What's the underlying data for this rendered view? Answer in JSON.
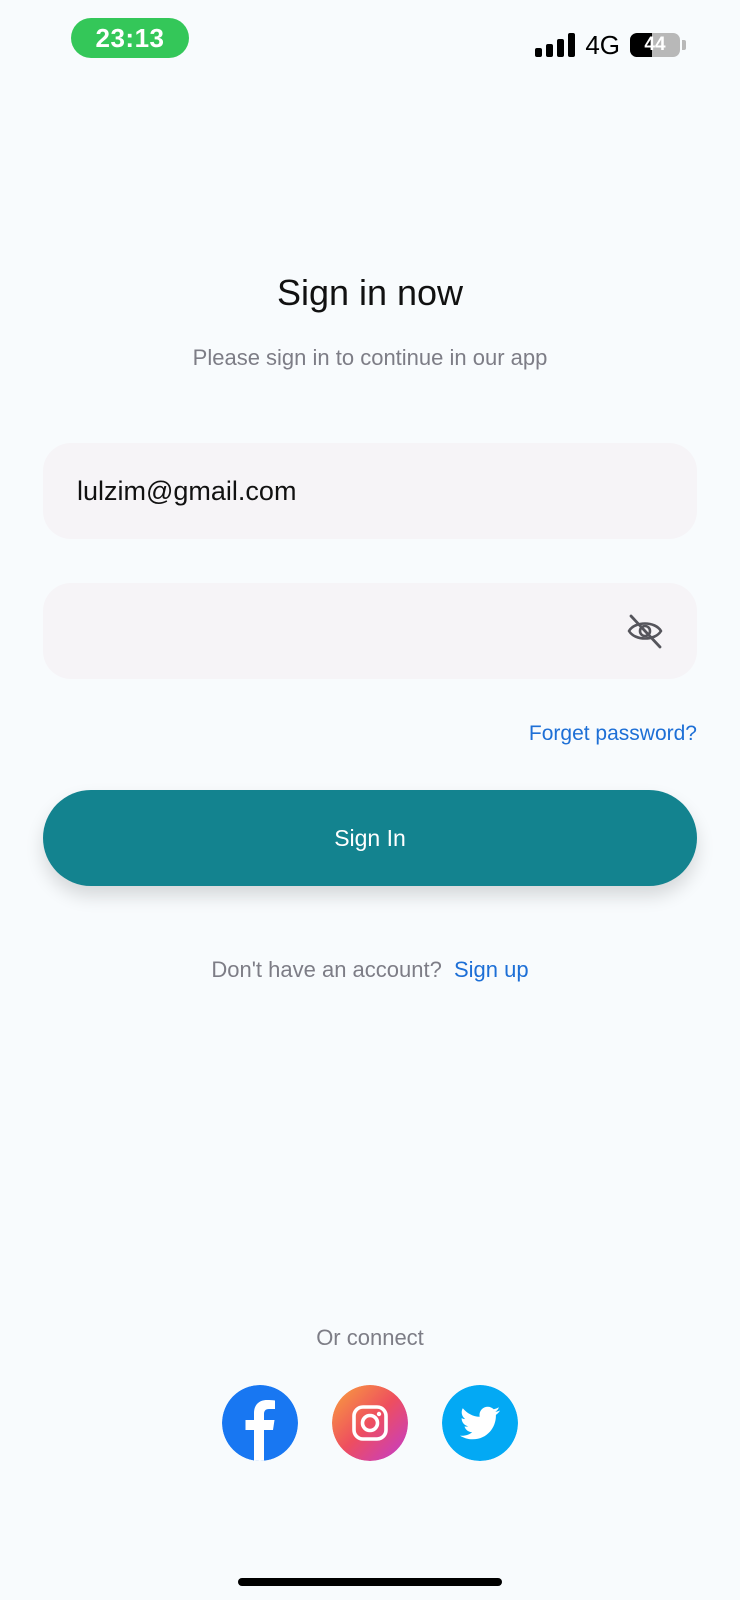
{
  "status_bar": {
    "time": "23:13",
    "network": "4G",
    "battery": "44",
    "battery_level": 0.44
  },
  "title": "Sign in now",
  "subtitle": "Please sign in to continue in our app",
  "email_value": "lulzim@gmail.com",
  "password_value": "",
  "forgot_label": "Forget password?",
  "signin_label": "Sign In",
  "no_account_text": "Don't have an account?",
  "signup_label": "Sign up",
  "or_connect": "Or connect",
  "socials": [
    "facebook-icon",
    "instagram-icon",
    "twitter-icon"
  ],
  "colors": {
    "accent": "#13838f",
    "link": "#1d6fd6",
    "time_pill": "#34c759"
  }
}
